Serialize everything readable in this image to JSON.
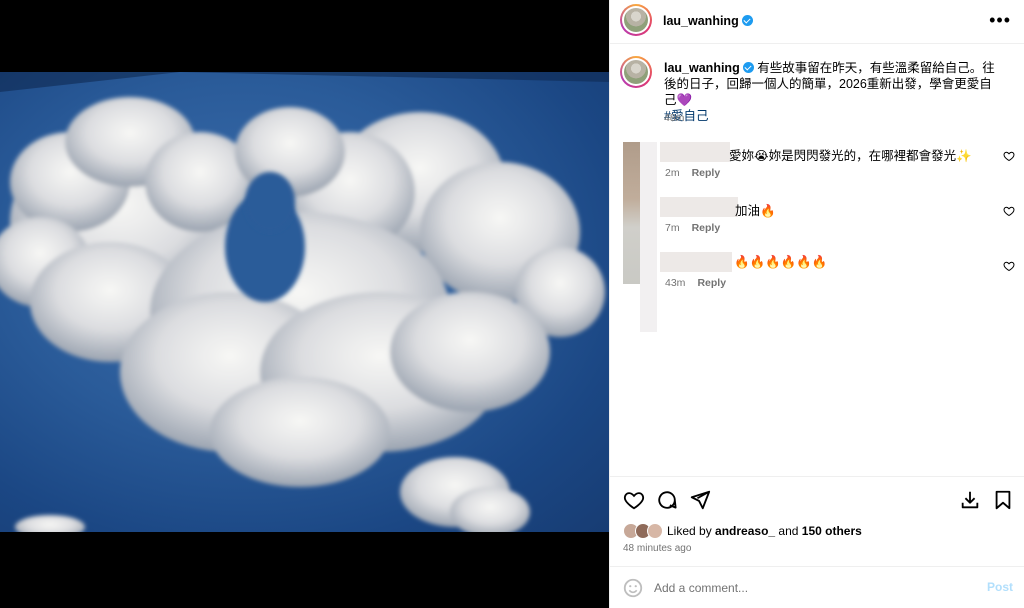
{
  "post": {
    "username": "lau_wanhing",
    "caption": "有些故事留在昨天，有些溫柔留給自己。往後的日子，回歸一個人的簡單，2026重新出發，學會更愛自己💜",
    "hashtag": "#愛自己",
    "caption_time": "48m",
    "more_icon": "more-horizontal-icon"
  },
  "comments": [
    {
      "text": "愛妳😭妳是閃閃發光的，在哪裡都會發光✨",
      "time": "2m",
      "reply_label": "Reply"
    },
    {
      "text": "加油🔥",
      "time": "7m",
      "reply_label": "Reply"
    },
    {
      "text": "🔥🔥🔥🔥🔥🔥",
      "time": "43m",
      "reply_label": "Reply"
    }
  ],
  "actions": {
    "icons": [
      "heart-icon",
      "comment-icon",
      "share-icon",
      "download-icon",
      "bookmark-icon"
    ]
  },
  "likes": {
    "prefix": "Liked by",
    "user": "andreaso_",
    "middle": "and",
    "others": "150 others",
    "time_ago": "48 minutes ago"
  },
  "add_comment": {
    "placeholder": "Add a comment...",
    "post_label": "Post",
    "post_color": "#b2dffc"
  },
  "colors": {
    "verified": "#1d9bf0",
    "hashtag": "#00376b",
    "muted": "#737373"
  }
}
